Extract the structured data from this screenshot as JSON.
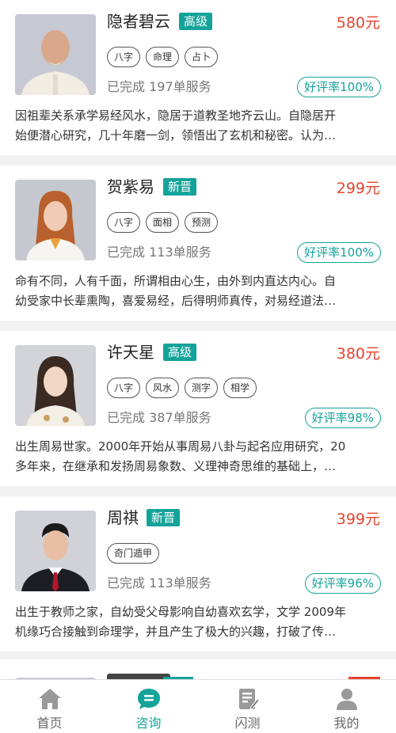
{
  "colors": {
    "accent": "#14a39a",
    "price": "#e5452f",
    "muted": "#777777"
  },
  "masters": [
    {
      "name": "隐者碧云",
      "level": "高级",
      "price": "580元",
      "tags": [
        "八字",
        "命理",
        "占卜"
      ],
      "completed": "已完成 197单服务",
      "rating": "好评率100%",
      "desc_line1": "因祖辈关系承学易经风水，隐居于道教圣地齐云山。自隐居开",
      "desc_line2": "始便潜心研究，几十年磨一剑，领悟出了玄机和秘密。认为…"
    },
    {
      "name": "贺紫易",
      "level": "新晋",
      "price": "299元",
      "tags": [
        "八字",
        "面相",
        "预测"
      ],
      "completed": "已完成 113单服务",
      "rating": "好评率100%",
      "desc_line1": "命有不同，人有千面，所谓相由心生，由外到内直达内心。自",
      "desc_line2": "幼受家中长辈熏陶，喜爱易经，后得明师真传，对易经道法…"
    },
    {
      "name": "许天星",
      "level": "高级",
      "price": "380元",
      "tags": [
        "八字",
        "风水",
        "测字",
        "相学"
      ],
      "completed": "已完成 387单服务",
      "rating": "好评率98%",
      "desc_line1": "出生周易世家。2000年开始从事周易八卦与起名应用研究，20",
      "desc_line2": "多年来，在继承和发扬周易象数、义理神奇思维的基础上，…"
    },
    {
      "name": "周祺",
      "level": "新晋",
      "price": "399元",
      "tags": [
        "奇门遁甲"
      ],
      "completed": "已完成 113单服务",
      "rating": "好评率96%",
      "desc_line1": "出生于教师之家，自幼受父母影响自幼喜欢玄学，文学 2009年",
      "desc_line2": "机缘巧合接触到命理学，并且产生了极大的兴趣，打破了传…"
    }
  ],
  "tabbar": [
    {
      "label": "首页",
      "icon": "home-icon",
      "active": false
    },
    {
      "label": "咨询",
      "icon": "chat-icon",
      "active": true
    },
    {
      "label": "闪测",
      "icon": "notepad-icon",
      "active": false
    },
    {
      "label": "我的",
      "icon": "user-icon",
      "active": false
    }
  ]
}
